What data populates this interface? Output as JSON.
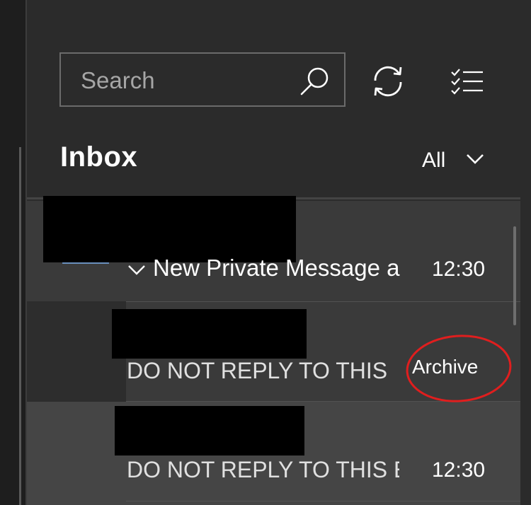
{
  "search": {
    "placeholder": "Search"
  },
  "icons": {
    "search": "search-icon",
    "sync": "sync-icon",
    "select": "select-mode-icon",
    "chevron": "chevron-down-icon"
  },
  "header": {
    "title": "Inbox",
    "filter_label": "All"
  },
  "messages": [
    {
      "subject": "New Private Message a",
      "time": "12:30"
    },
    {
      "preview": "DO NOT REPLY TO THIS",
      "hover_action": "Archive"
    },
    {
      "preview": "DO NOT REPLY TO THIS E",
      "time": "12:30"
    }
  ],
  "colors": {
    "annotation": "#e01e1e",
    "avatar": "#6a8fbd",
    "pane_bg": "#2b2b2b"
  }
}
